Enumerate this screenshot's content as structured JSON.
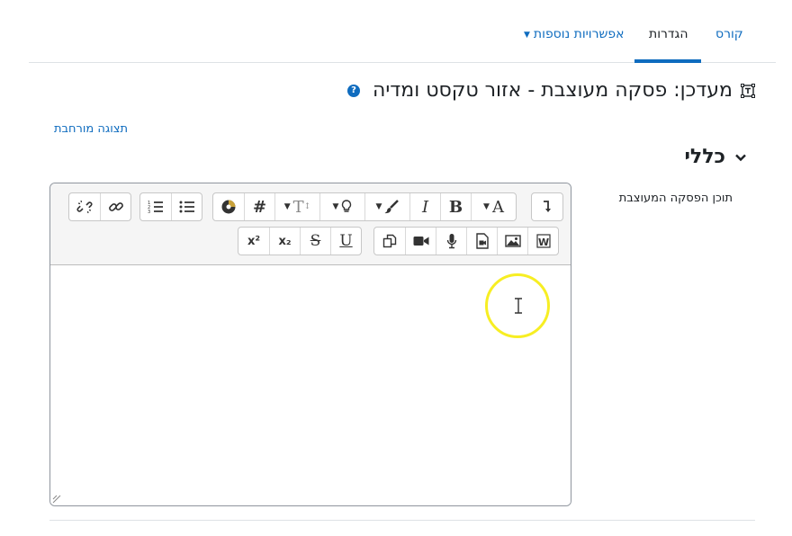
{
  "tabs": {
    "course": "קורס",
    "settings": "הגדרות",
    "more": "אפשרויות נוספות"
  },
  "page": {
    "title": "מעדכן: פסקה מעוצבת - אזור טקסט ומדיה",
    "expand_all": "תצוגה מורחבת"
  },
  "section": {
    "title": "כללי",
    "field_label": "תוכן הפסקה המעוצבת"
  },
  "editor": {
    "toolbar_row1": [
      "unlink",
      "link",
      "ordered-list",
      "unordered-list",
      "accessibility",
      "hashtag",
      "font-size",
      "highlight",
      "brush",
      "italic",
      "bold",
      "font-color",
      "show-more"
    ],
    "toolbar_row2": [
      "superscript",
      "subscript",
      "strikethrough",
      "underline",
      "copy",
      "video",
      "microphone",
      "media",
      "image",
      "word-paste"
    ],
    "labels": {
      "italic": "I",
      "bold": "B",
      "font_color": "A",
      "superscript": "x²",
      "subscript": "x₂",
      "underline": "U",
      "strike": "S",
      "hashtag": "#",
      "font_size": "T"
    }
  },
  "colors": {
    "link": "#0f6cbf",
    "text": "#1d2125",
    "cursor_ring": "#f7ee23"
  }
}
